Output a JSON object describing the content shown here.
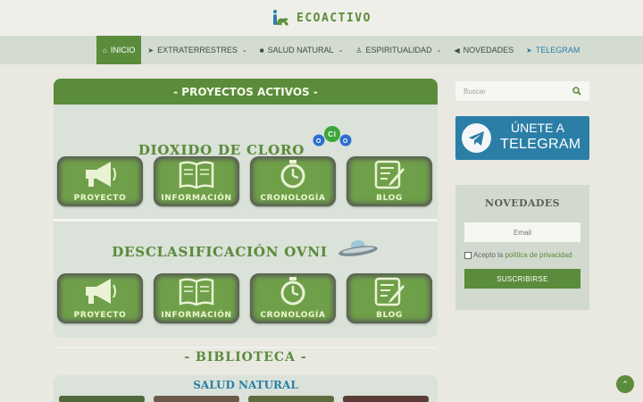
{
  "brand": {
    "name": "ECOACTIVO",
    "logo_icon": "ecoactivo-logo-icon"
  },
  "nav": {
    "items": [
      {
        "label": "INICIO",
        "icon": "home-icon"
      },
      {
        "label": "EXTRATERRESTRES",
        "icon": "rocket-icon"
      },
      {
        "label": "SALUD NATURAL",
        "icon": "briefcase-icon"
      },
      {
        "label": "ESPIRITUALIDAD",
        "icon": "male-icon"
      },
      {
        "label": "NOVEDADES",
        "icon": "megaphone-icon"
      },
      {
        "label": "TELEGRAM",
        "icon": "paper-plane-icon"
      }
    ]
  },
  "main": {
    "title": "- PROYECTOS ACTIVOS -",
    "projects": [
      {
        "title": "DIOXIDO DE CLORO",
        "molecule": [
          "O",
          "Cl",
          "O"
        ]
      },
      {
        "title": "DESCLASIFICACIÓN OVNI"
      }
    ],
    "card_labels": [
      "PROYECTO",
      "INFORMACIÓN",
      "CRONOLOGÍA",
      "BLOG"
    ]
  },
  "biblioteca": {
    "title": "- BIBLIOTECA -",
    "section": "SALUD NATURAL"
  },
  "sidebar": {
    "search_placeholder": "Buscar",
    "telegram_line1": "ÚNETE A",
    "telegram_line2": "TELEGRAM",
    "news_title": "NOVEDADES",
    "email_placeholder": "Email",
    "consent_prefix": "Acepto la ",
    "consent_link": "política de privacidad",
    "subscribe": "SUSCRIBIRSE"
  },
  "colors": {
    "accent": "#5a8c3b",
    "telegram": "#2b7fa7",
    "panel": "#dbe2d9"
  }
}
